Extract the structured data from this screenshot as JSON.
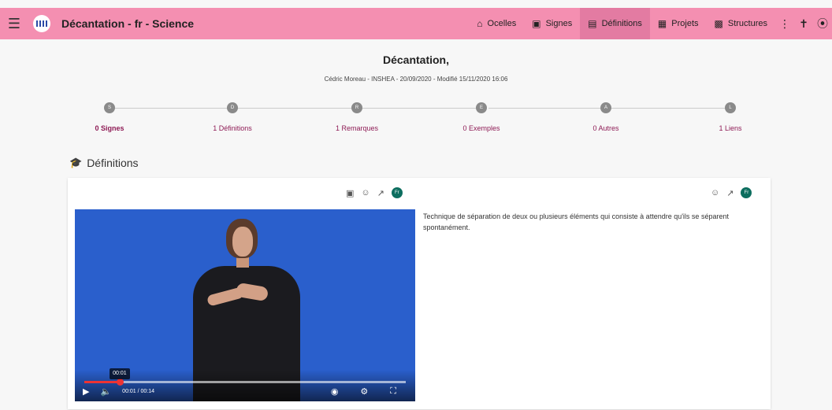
{
  "app": {
    "title": "Décantation - fr - Science"
  },
  "nav": [
    {
      "label": "Ocelles",
      "icon": "home-icon"
    },
    {
      "label": "Signes",
      "icon": "image-icon"
    },
    {
      "label": "Définitions",
      "icon": "list-icon",
      "active": true
    },
    {
      "label": "Projets",
      "icon": "grid-icon"
    },
    {
      "label": "Structures",
      "icon": "building-icon"
    }
  ],
  "page": {
    "title": "Décantation,",
    "meta": "Cédric Moreau - INSHEA - 20/09/2020 - Modifié 15/11/2020 16:06"
  },
  "steps": [
    {
      "letter": "S",
      "label": "0 Signes",
      "bold": true
    },
    {
      "letter": "D",
      "label": "1 Définitions"
    },
    {
      "letter": "R",
      "label": "1 Remarques"
    },
    {
      "letter": "E",
      "label": "0 Exemples"
    },
    {
      "letter": "A",
      "label": "0 Autres"
    },
    {
      "letter": "L",
      "label": "1 Liens"
    }
  ],
  "section": {
    "title": "Définitions"
  },
  "definition": {
    "lang_badge": "Fr",
    "text": "Technique de séparation de deux ou plusieurs éléments qui consiste à attendre qu'ils se séparent spontanément.",
    "video": {
      "tooltip_time": "00:01",
      "time": "00:01 / 00:14",
      "progress": 0.11
    }
  },
  "colors": {
    "topbar": "#f48fb1",
    "active_nav": "#e37ba2",
    "accent": "#8e1b55",
    "badge": "#0d6e5f",
    "video_bg": "#2a5fcc"
  }
}
